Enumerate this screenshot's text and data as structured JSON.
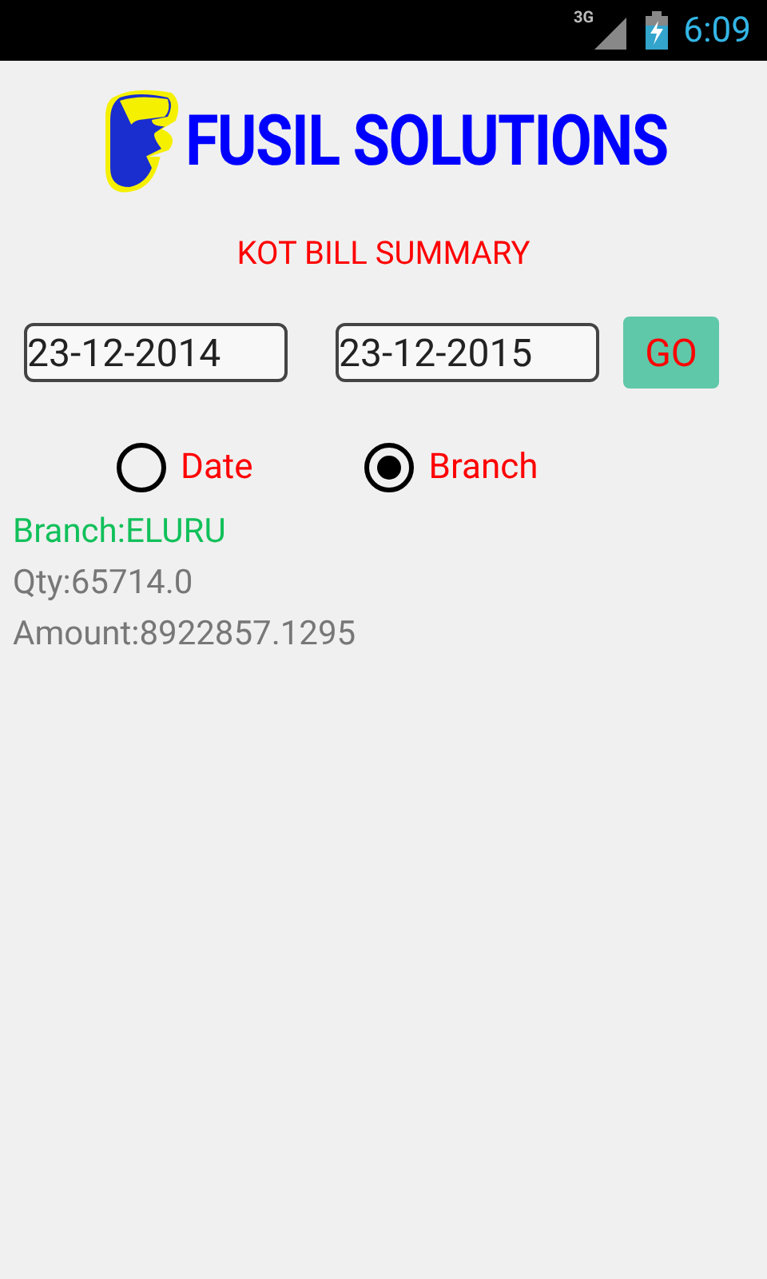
{
  "status_bar": {
    "network": "3G",
    "time": "6:09"
  },
  "header": {
    "brand": "FUSIL SOLUTIONS"
  },
  "title": "KOT BILL SUMMARY",
  "filters": {
    "from_date": "23-12-2014",
    "to_date": "23-12-2015",
    "go_button": "GO"
  },
  "modes": [
    {
      "label": "Date",
      "selected": false
    },
    {
      "label": "Branch",
      "selected": true
    }
  ],
  "results": [
    {
      "kind": "heading",
      "text": "Branch:ELURU"
    },
    {
      "kind": "value",
      "text": "Qty:65714.0"
    },
    {
      "kind": "value",
      "text": "Amount:8922857.1295"
    }
  ]
}
